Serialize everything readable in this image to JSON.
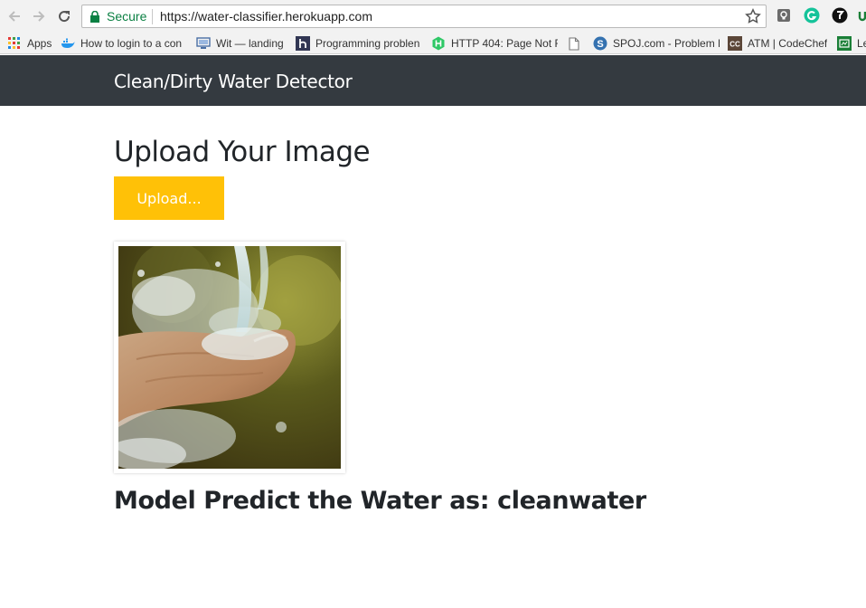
{
  "browser": {
    "secure_label": "Secure",
    "url": "https://water-classifier.herokuapp.com",
    "bookmarks": [
      {
        "label": "Apps",
        "icon": "apps-grid-icon"
      },
      {
        "label": "How to login to a con",
        "icon": "docker-whale-icon"
      },
      {
        "label": "Wit — landing",
        "icon": "wit-icon"
      },
      {
        "label": "Programming problen",
        "icon": "hackerearth-icon"
      },
      {
        "label": "HTTP 404: Page Not F",
        "icon": "hackerrank-icon"
      },
      {
        "label": "",
        "icon": "blank-page-icon"
      },
      {
        "label": "SPOJ.com - Problem P",
        "icon": "spoj-icon"
      },
      {
        "label": "ATM | CodeChef",
        "icon": "codechef-icon"
      },
      {
        "label": "Le",
        "icon": "leetcode-icon"
      }
    ]
  },
  "navbar": {
    "brand": "Clean/Dirty Water Detector"
  },
  "main": {
    "title": "Upload Your Image",
    "upload_label": "Upload...",
    "result_text": "Model Predict the Water as: cleanwater"
  },
  "colors": {
    "navbar_bg": "#343a40",
    "upload_button": "#ffc107",
    "secure_green": "#0b8043"
  }
}
